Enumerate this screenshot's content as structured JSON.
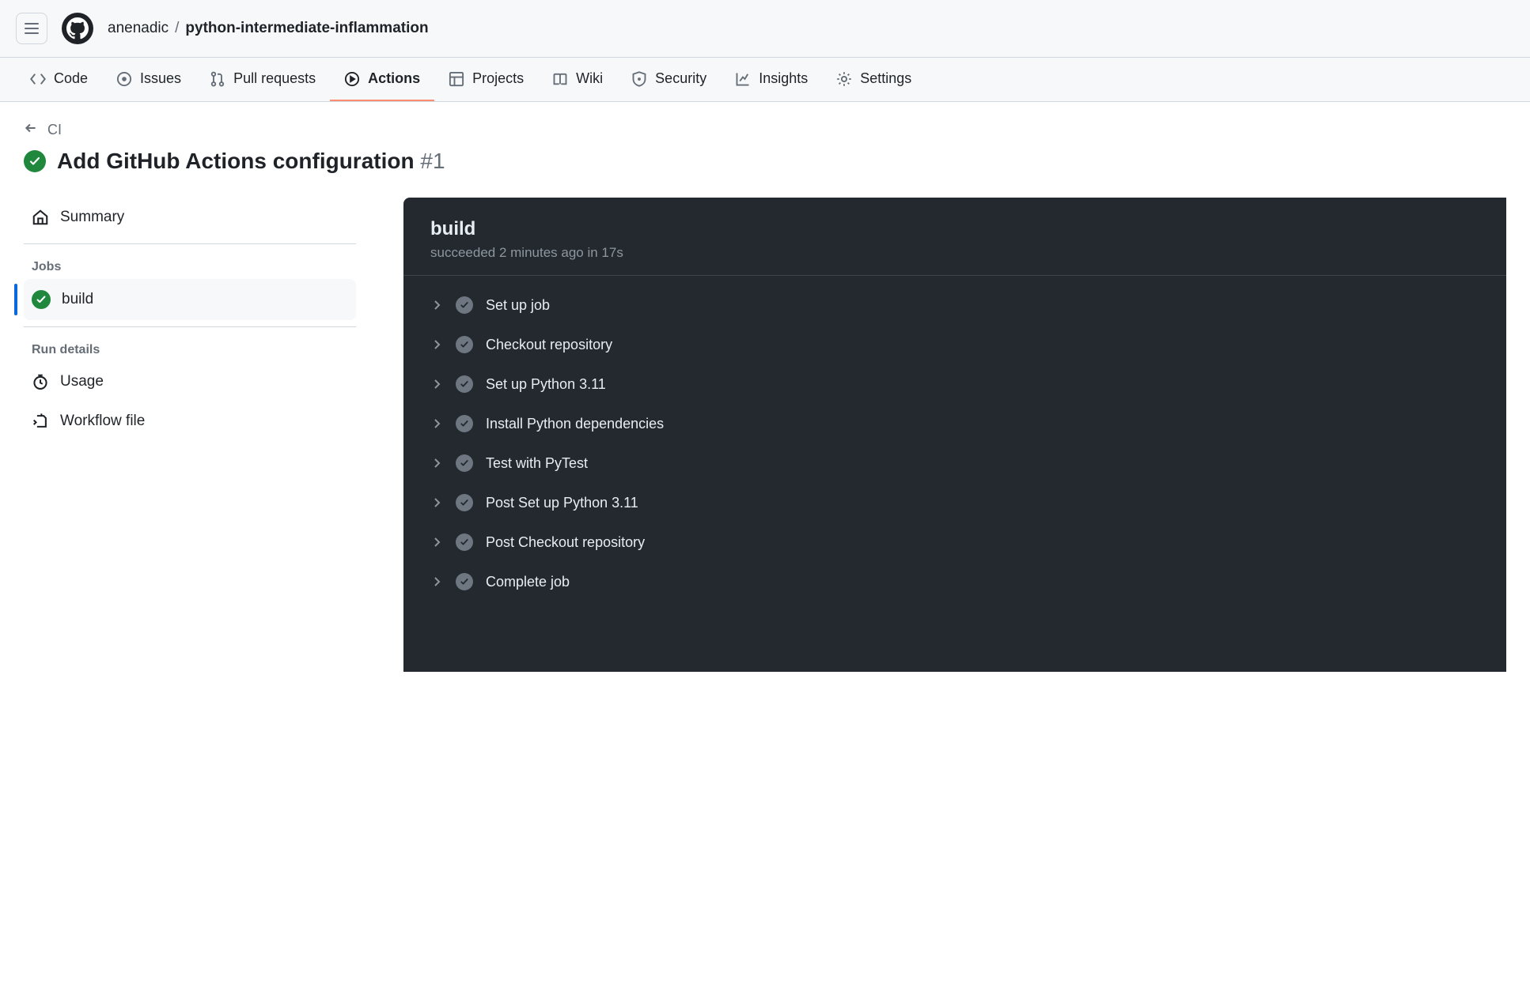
{
  "breadcrumb": {
    "owner": "anenadic",
    "sep": "/",
    "repo": "python-intermediate-inflammation"
  },
  "nav": {
    "code": "Code",
    "issues": "Issues",
    "pull_requests": "Pull requests",
    "actions": "Actions",
    "projects": "Projects",
    "wiki": "Wiki",
    "security": "Security",
    "insights": "Insights",
    "settings": "Settings"
  },
  "back_label": "CI",
  "run": {
    "title": "Add GitHub Actions configuration",
    "number": "#1"
  },
  "sidebar": {
    "summary": "Summary",
    "jobs_heading": "Jobs",
    "job_build": "build",
    "run_details_heading": "Run details",
    "usage": "Usage",
    "workflow_file": "Workflow file"
  },
  "job": {
    "name": "build",
    "meta": "succeeded 2 minutes ago in 17s",
    "steps": [
      {
        "name": "Set up job"
      },
      {
        "name": "Checkout repository"
      },
      {
        "name": "Set up Python 3.11"
      },
      {
        "name": "Install Python dependencies"
      },
      {
        "name": "Test with PyTest"
      },
      {
        "name": "Post Set up Python 3.11"
      },
      {
        "name": "Post Checkout repository"
      },
      {
        "name": "Complete job"
      }
    ]
  }
}
